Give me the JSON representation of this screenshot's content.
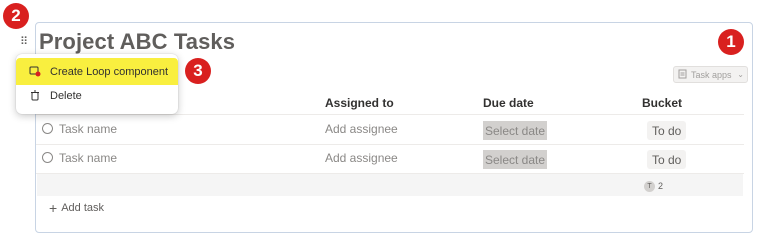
{
  "page": {
    "title": "Project ABC Tasks"
  },
  "badges": [
    "1",
    "2",
    "3"
  ],
  "toolbar": {
    "task_apps_label": "Task apps"
  },
  "context_menu": {
    "items": [
      {
        "label": "Create Loop component",
        "icon": "loop-component-icon",
        "highlight": "#f9ef3f"
      },
      {
        "label": "Delete",
        "icon": "trash-icon"
      }
    ]
  },
  "table": {
    "columns": [
      "Assigned to",
      "Due date",
      "Bucket"
    ],
    "rows": [
      {
        "task_placeholder": "Task name",
        "assignee_placeholder": "Add assignee",
        "due_placeholder": "Select date",
        "bucket": "To do"
      },
      {
        "task_placeholder": "Task name",
        "assignee_placeholder": "Add assignee",
        "due_placeholder": "Select date",
        "bucket": "To do"
      }
    ],
    "summary": {
      "avatar_letter": "T",
      "count": "2"
    },
    "add_task_label": "Add task"
  },
  "colors": {
    "badge": "#d9201f",
    "card_border": "#c8d4e4"
  }
}
